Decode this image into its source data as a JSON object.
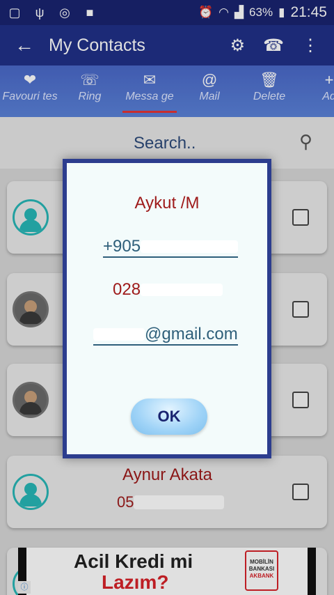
{
  "statusbar": {
    "battery": "63%",
    "time": "21:45"
  },
  "appbar": {
    "title": "My Contacts",
    "back_icon": "arrow-back-icon",
    "settings_icon": "gear-icon",
    "dialpad_icon": "dialpad-icon",
    "overflow_icon": "more-vert-icon"
  },
  "tabs": [
    {
      "label": "Favouri tes",
      "icon": "heart-folder-icon"
    },
    {
      "label": "Ring",
      "icon": "phone-icon"
    },
    {
      "label": "Messa ge",
      "icon": "envelope-icon"
    },
    {
      "label": "Mail",
      "icon": "address-book-icon"
    },
    {
      "label": "Delete",
      "icon": "trash-icon"
    },
    {
      "label": "Ad",
      "icon": "add-user-icon"
    }
  ],
  "search": {
    "placeholder": "Search.."
  },
  "contacts": [
    {
      "name": "Aynur Akata",
      "phone_prefix": "05"
    }
  ],
  "dialog": {
    "name": "Aykut /M",
    "phone1_prefix": "+905",
    "phone2_prefix": "028",
    "email_suffix": "@gmail.com",
    "ok_label": "OK"
  },
  "ad": {
    "line1": "Acil Kredi mi",
    "line2": "Lazım?",
    "logo_line1": "MOBİLİN",
    "logo_line2": "BANKASI",
    "logo_line3": "AKBANK"
  },
  "colors": {
    "statusbar": "#1a2470",
    "appbar": "#203088",
    "name_red": "#9e1a1a",
    "link_teal": "#2e5f7a",
    "avatar_teal": "#27b7b7"
  }
}
